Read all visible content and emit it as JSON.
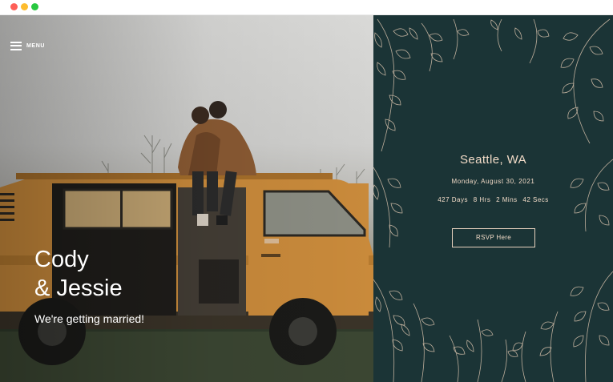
{
  "window": {
    "dots": [
      "close",
      "minimize",
      "maximize"
    ]
  },
  "hero": {
    "menu_label": "MENU",
    "name_line1": "Cody",
    "name_line2": "& Jessie",
    "tagline": "We're getting married!"
  },
  "details": {
    "location": "Seattle, WA",
    "date": "Monday, August 30, 2021",
    "countdown": {
      "days": "427 Days",
      "hours": "8 Hrs",
      "mins": "2 Mins",
      "secs": "42 Secs"
    },
    "rsvp_label": "RSVP Here"
  },
  "colors": {
    "panel_bg": "#1b3436",
    "accent_text": "#f3dcc8",
    "leaf_stroke": "#d9c3ad",
    "van_orange": "#c98a3b"
  }
}
